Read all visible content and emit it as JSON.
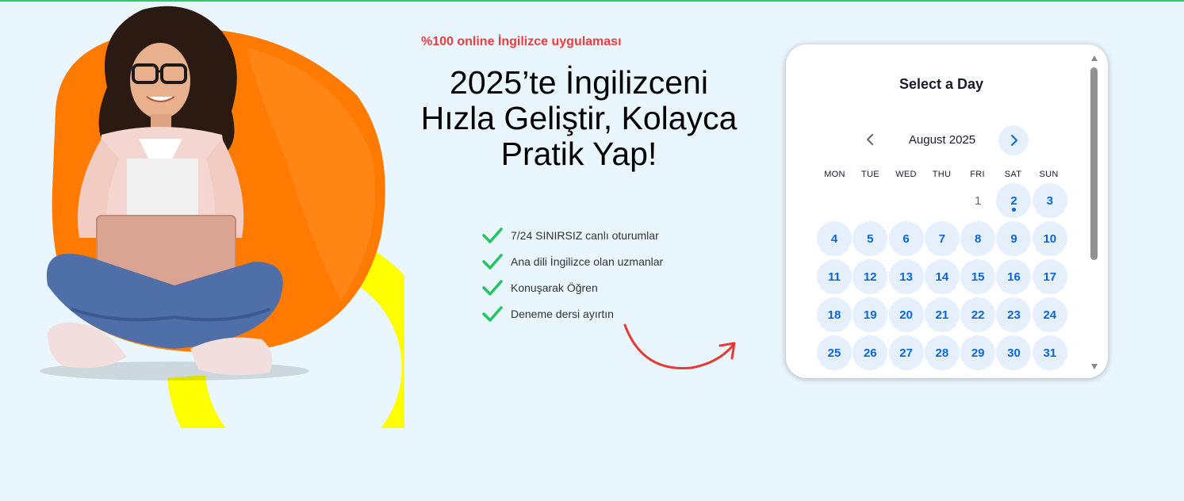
{
  "hero": {
    "tagline": "%100 online İngilizce uygulaması",
    "headline": "2025’te İngilizceni Hızla Geliştir, Kolayca Pratik Yap!",
    "features": [
      "7/24 SINIRSIZ canlı oturumlar",
      "Ana dili İngilizce olan uzmanlar",
      "Konuşarak Öğren",
      "Deneme dersi ayırtın"
    ],
    "colors": {
      "tagline": "#ef3b3b",
      "check": "#22c55e",
      "arrow": "#e53935",
      "orange": "#ff7a00",
      "yellow": "#ffff00"
    }
  },
  "calendar": {
    "title": "Select a Day",
    "month_label": "August 2025",
    "weekdays": [
      "MON",
      "TUE",
      "WED",
      "THU",
      "FRI",
      "SAT",
      "SUN"
    ],
    "days": [
      {
        "label": "",
        "state": "empty"
      },
      {
        "label": "",
        "state": "empty"
      },
      {
        "label": "",
        "state": "empty"
      },
      {
        "label": "",
        "state": "empty"
      },
      {
        "label": "1",
        "state": "disabled"
      },
      {
        "label": "2",
        "state": "today"
      },
      {
        "label": "3",
        "state": "available"
      },
      {
        "label": "4",
        "state": "available"
      },
      {
        "label": "5",
        "state": "available"
      },
      {
        "label": "6",
        "state": "available"
      },
      {
        "label": "7",
        "state": "available"
      },
      {
        "label": "8",
        "state": "available"
      },
      {
        "label": "9",
        "state": "available"
      },
      {
        "label": "10",
        "state": "available"
      },
      {
        "label": "11",
        "state": "available"
      },
      {
        "label": "12",
        "state": "available"
      },
      {
        "label": "13",
        "state": "available"
      },
      {
        "label": "14",
        "state": "available"
      },
      {
        "label": "15",
        "state": "available"
      },
      {
        "label": "16",
        "state": "available"
      },
      {
        "label": "17",
        "state": "available"
      },
      {
        "label": "18",
        "state": "available"
      },
      {
        "label": "19",
        "state": "available"
      },
      {
        "label": "20",
        "state": "available"
      },
      {
        "label": "21",
        "state": "available"
      },
      {
        "label": "22",
        "state": "available"
      },
      {
        "label": "23",
        "state": "available"
      },
      {
        "label": "24",
        "state": "available"
      },
      {
        "label": "25",
        "state": "available"
      },
      {
        "label": "26",
        "state": "available"
      },
      {
        "label": "27",
        "state": "available"
      },
      {
        "label": "28",
        "state": "available"
      },
      {
        "label": "29",
        "state": "available"
      },
      {
        "label": "30",
        "state": "available"
      },
      {
        "label": "31",
        "state": "available"
      }
    ],
    "icons": {
      "prev": "chevron-left-icon",
      "next": "chevron-right-icon"
    },
    "colors": {
      "accent": "#0a66d8",
      "day_bg": "#e6f0fd"
    }
  }
}
